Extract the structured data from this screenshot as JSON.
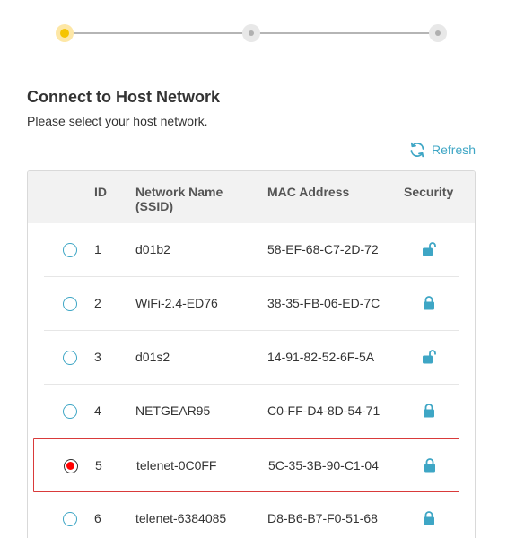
{
  "stepper": {
    "steps": [
      "step-1-active",
      "step-2",
      "step-3"
    ],
    "active_color": "#f5c400"
  },
  "page": {
    "title": "Connect to Host Network",
    "subtitle": "Please select your host network."
  },
  "refresh": {
    "label": "Refresh",
    "icon": "refresh-icon"
  },
  "accent_color": "#3ea6c5",
  "table": {
    "columns": {
      "id": "ID",
      "ssid": "Network Name (SSID)",
      "mac": "MAC Address",
      "security": "Security"
    },
    "rows": [
      {
        "id": "1",
        "ssid": "d01b2",
        "mac": "58-EF-68-C7-2D-72",
        "security": "unlocked-icon",
        "selected": false
      },
      {
        "id": "2",
        "ssid": "WiFi-2.4-ED76",
        "mac": "38-35-FB-06-ED-7C",
        "security": "lock-icon",
        "selected": false
      },
      {
        "id": "3",
        "ssid": "d01s2",
        "mac": "14-91-82-52-6F-5A",
        "security": "unlocked-icon",
        "selected": false
      },
      {
        "id": "4",
        "ssid": "NETGEAR95",
        "mac": "C0-FF-D4-8D-54-71",
        "security": "lock-icon",
        "selected": false
      },
      {
        "id": "5",
        "ssid": "telenet-0C0FF",
        "mac": "5C-35-3B-90-C1-04",
        "security": "lock-icon",
        "selected": true
      },
      {
        "id": "6",
        "ssid": "telenet-6384085",
        "mac": "D8-B6-B7-F0-51-68",
        "security": "lock-icon",
        "selected": false
      }
    ]
  }
}
